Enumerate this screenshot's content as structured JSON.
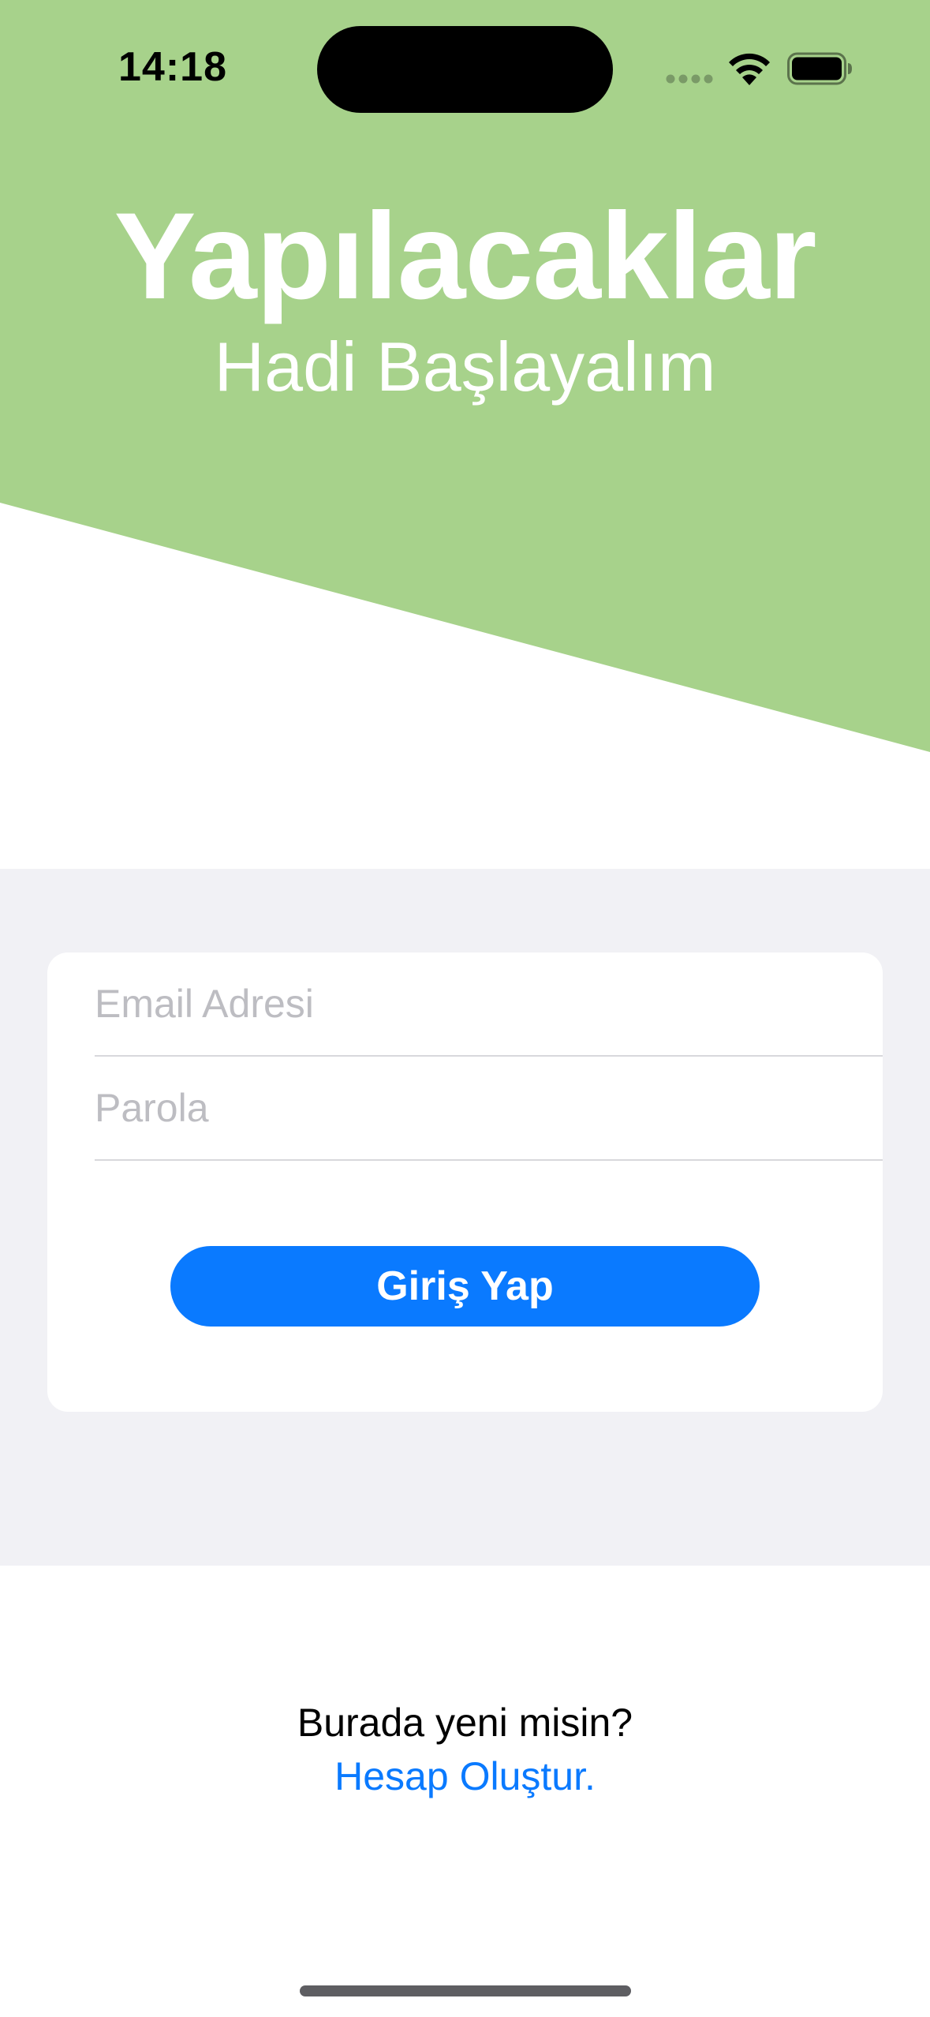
{
  "status_bar": {
    "time": "14:18",
    "wifi_icon": "wifi-icon",
    "battery_icon": "battery-full-icon",
    "signal_icon": "cellular-dots-icon"
  },
  "header": {
    "title": "Yapılacaklar",
    "subtitle": "Hadi Başlayalım",
    "background_color": "#a7d28b"
  },
  "login_form": {
    "email_placeholder": "Email Adresi",
    "email_value": "",
    "password_placeholder": "Parola",
    "password_value": "",
    "submit_label": "Giriş Yap",
    "submit_color": "#0a7aff"
  },
  "footer": {
    "prompt": "Burada yeni misin?",
    "create_account_link": "Hesap Oluştur."
  }
}
